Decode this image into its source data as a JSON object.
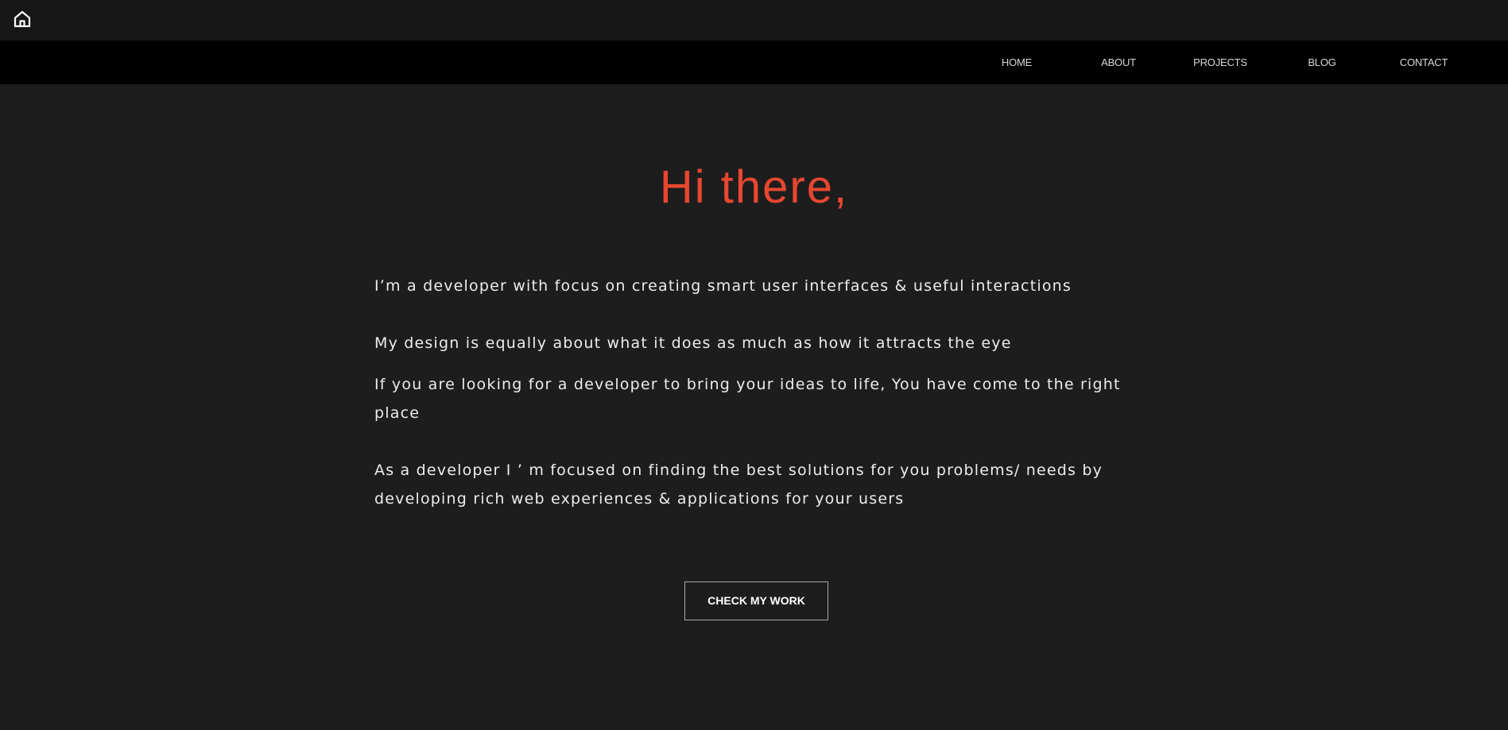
{
  "topbar": {
    "home_icon": "home-icon"
  },
  "nav": {
    "items": [
      {
        "label": "HOME"
      },
      {
        "label": "ABOUT"
      },
      {
        "label": "PROJECTS"
      },
      {
        "label": "BLOG"
      },
      {
        "label": "CONTACT"
      }
    ]
  },
  "hero": {
    "title": "Hi there,",
    "title_color": "#e8472f",
    "paragraphs": [
      "I’m a developer with focus on creating smart user interfaces & useful interactions",
      "My design is equally about what it does as much as how it attracts the eye",
      "If you are looking for a developer to bring your ideas to life, You have come to the right place",
      "As a developer I ’ m focused on finding the best solutions for you problems/ needs by developing rich web experiences & applications for your users"
    ],
    "cta_label": "CHECK MY WORK"
  },
  "colors": {
    "background": "#1e1d1e",
    "topbar": "#171717",
    "navbar": "#000000",
    "accent": "#e8472f"
  }
}
